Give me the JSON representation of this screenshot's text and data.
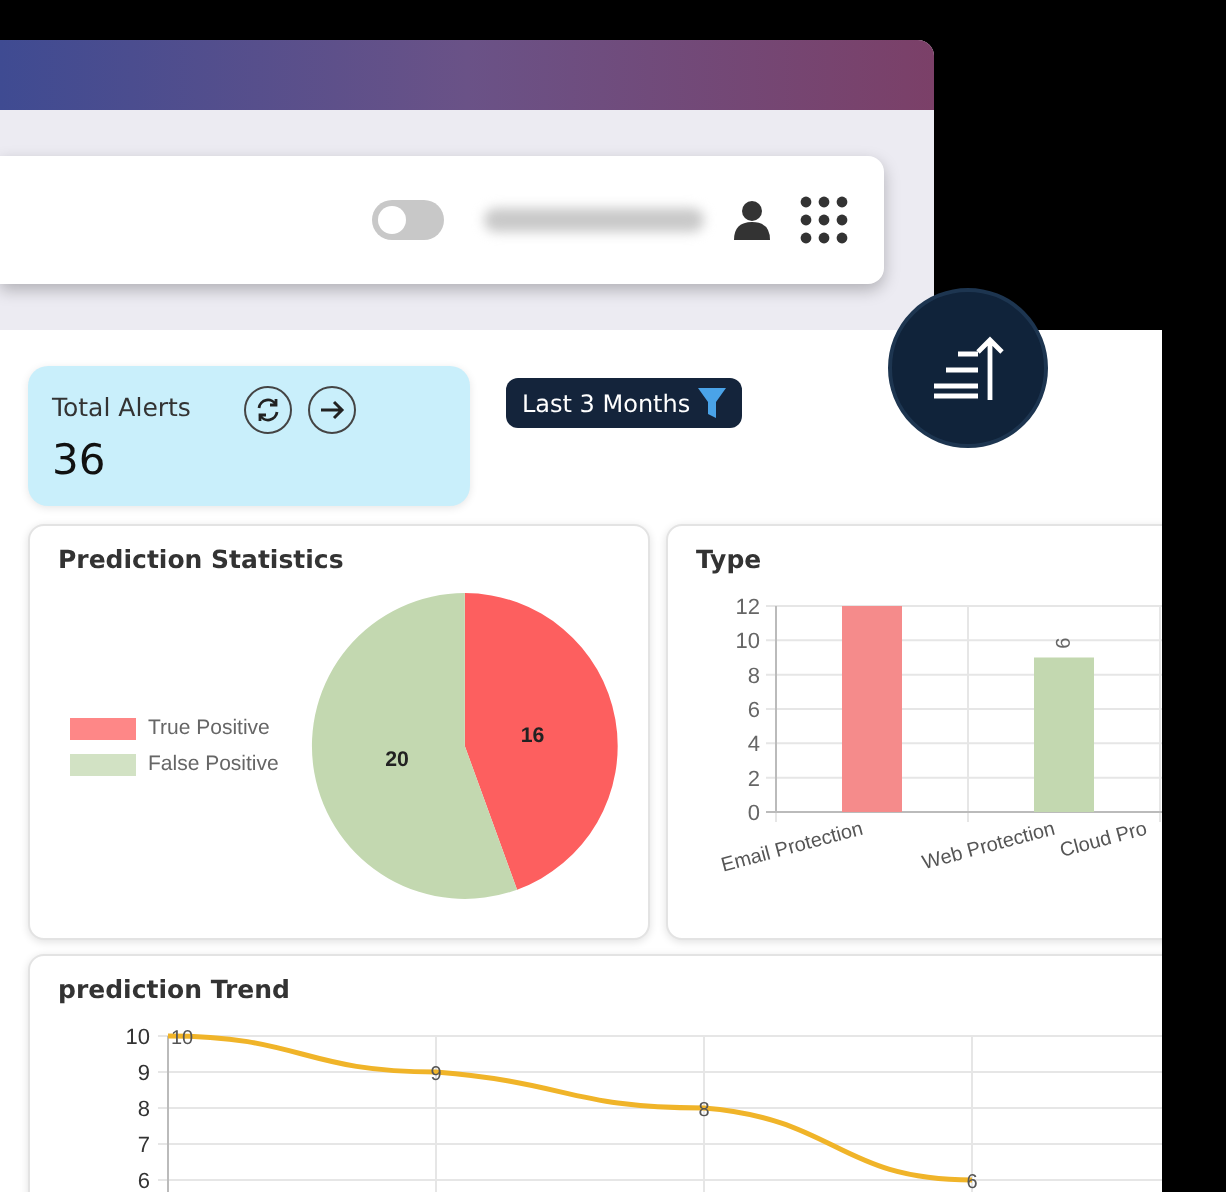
{
  "top_bar": {
    "toggle": {
      "on": false
    }
  },
  "summary": {
    "title": "Total Alerts",
    "value": "36"
  },
  "filter_button": {
    "label": "Last 3 Months"
  },
  "prediction_statistics": {
    "title": "Prediction Statistics",
    "chart_data": {
      "type": "pie",
      "data_labels": true,
      "categories": [
        "True Positive",
        "False Positive"
      ],
      "values": [
        16,
        20
      ],
      "colors": [
        "#fd5f5f",
        "#c3d8b0"
      ]
    }
  },
  "type": {
    "title": "Type",
    "chart_data": {
      "type": "bar",
      "grid": true,
      "categories": [
        "Email Protection",
        "Web Protection",
        "Cloud Pro"
      ],
      "yticks": [
        0,
        2,
        4,
        6,
        8,
        10,
        12
      ],
      "ylim": [
        0,
        12
      ],
      "value_labels": [
        null,
        "9",
        null
      ],
      "values": [
        12,
        9,
        null
      ],
      "colors": [
        "#f58b8b",
        "#c3d8b0",
        null
      ]
    }
  },
  "prediction_trend": {
    "title": "prediction Trend",
    "chart_data": {
      "type": "line",
      "grid": true,
      "ylim": [
        6,
        10
      ],
      "yticks": [
        6,
        7,
        8,
        9,
        10
      ],
      "data_labels": true,
      "series": [
        {
          "color": "#f0b429",
          "values": [
            10,
            9,
            8,
            6
          ]
        }
      ]
    }
  }
}
